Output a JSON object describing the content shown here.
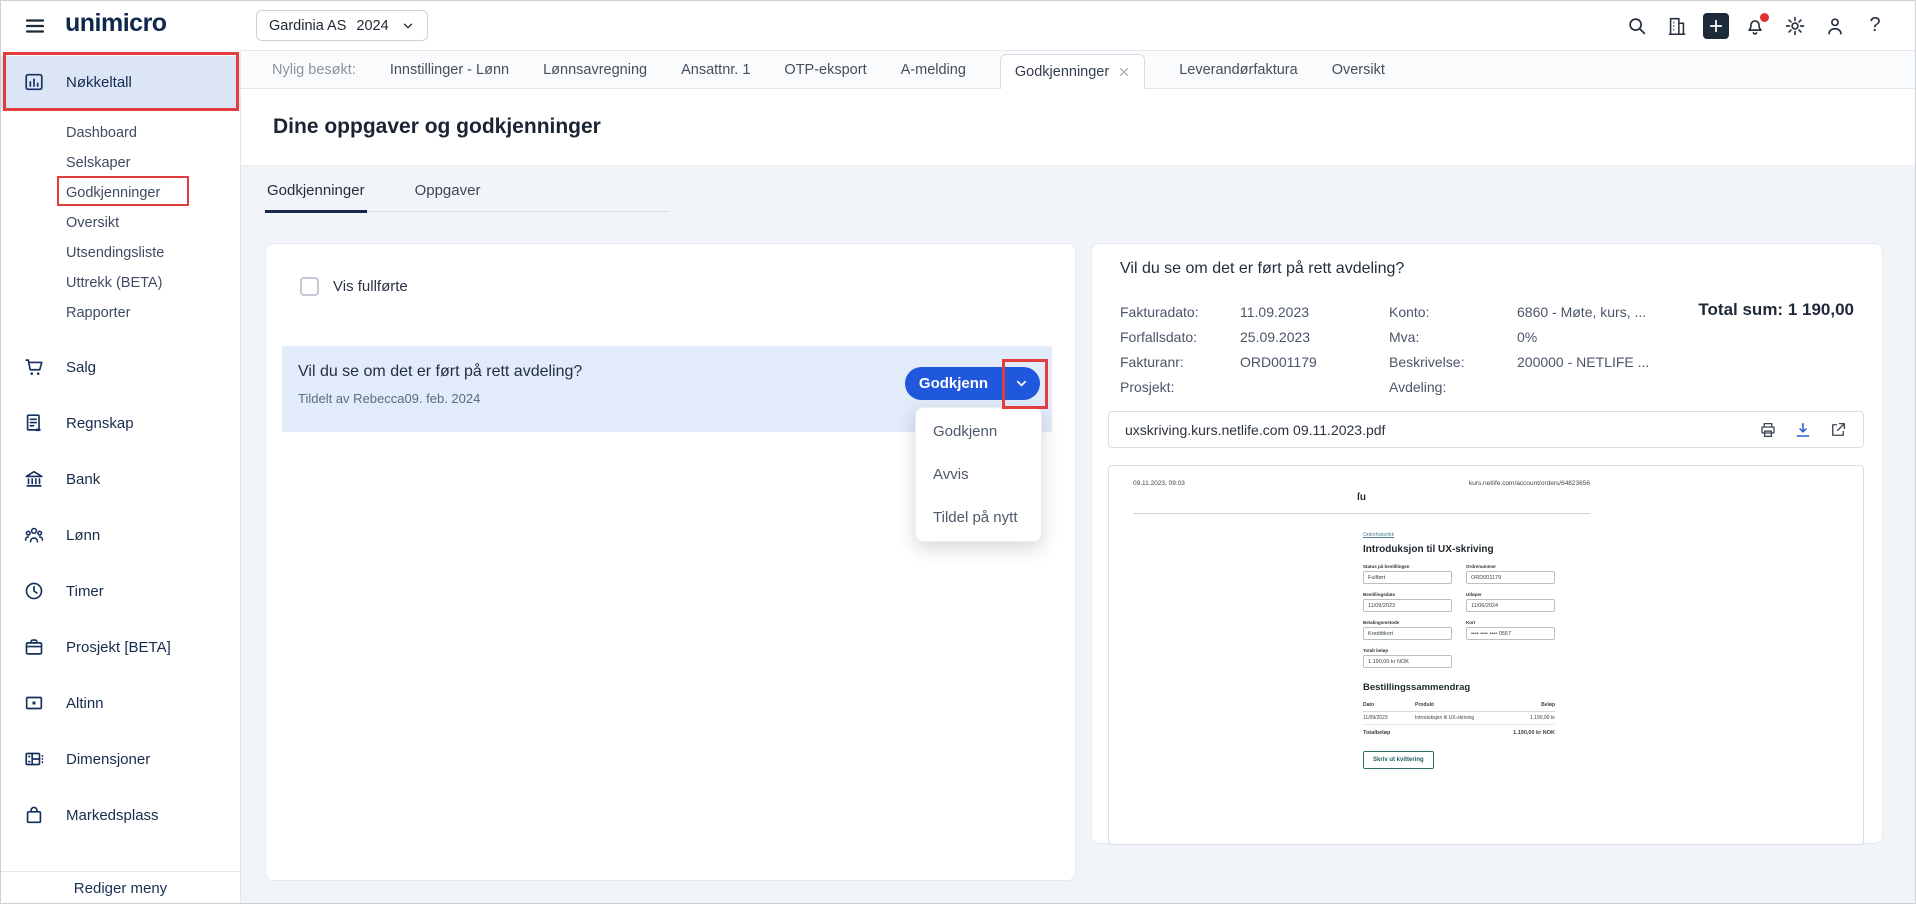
{
  "topbar": {
    "logo": "unimicro",
    "company": "Gardinia AS",
    "year": "2024",
    "icons": [
      "search-icon",
      "company-switcher-icon",
      "quick-add-icon",
      "notifications-bell-icon",
      "settings-gear-icon",
      "profile-icon",
      "help-icon"
    ],
    "help_glyph": "?"
  },
  "sidebar": {
    "items": [
      {
        "label": "Nøkkeltall",
        "icon": "bar-chart-icon"
      },
      {
        "label": "Salg",
        "icon": "cart-icon"
      },
      {
        "label": "Regnskap",
        "icon": "ledger-document-icon"
      },
      {
        "label": "Bank",
        "icon": "bank-icon"
      },
      {
        "label": "Lønn",
        "icon": "people-icon"
      },
      {
        "label": "Timer",
        "icon": "clock-icon"
      },
      {
        "label": "Prosjekt [BETA]",
        "icon": "briefcase-icon"
      },
      {
        "label": "Altinn",
        "icon": "altinn-icon"
      },
      {
        "label": "Dimensjoner",
        "icon": "dimensions-icon"
      },
      {
        "label": "Markedsplass",
        "icon": "shopping-bag-icon"
      }
    ],
    "sub_items": [
      "Dashboard",
      "Selskaper",
      "Godkjenninger",
      "Oversikt",
      "Utsendingsliste",
      "Uttrekk (BETA)",
      "Rapporter"
    ],
    "footer": "Rediger meny"
  },
  "recent": {
    "label": "Nylig besøkt:",
    "tabs": [
      "Innstillinger - Lønn",
      "Lønnsavregning",
      "Ansattnr. 1",
      "OTP-eksport",
      "A-melding"
    ],
    "active_tab": "Godkjenninger",
    "tabs_after": [
      "Leverandørfaktura",
      "Oversikt"
    ]
  },
  "page": {
    "title": "Dine oppgaver og godkjenninger",
    "tab_godkjenninger": "Godkjenninger",
    "tab_oppgaver": "Oppgaver"
  },
  "tasks": {
    "show_completed": "Vis fullførte",
    "task": {
      "title": "Vil du se om det er ført på rett avdeling?",
      "assigned": "Tildelt av Rebecca09. feb. 2024",
      "approve": "Godkjenn"
    },
    "menu": [
      "Godkjenn",
      "Avvis",
      "Tildel på nytt"
    ]
  },
  "detail": {
    "title": "Vil du se om det er ført på rett avdeling?",
    "total": "Total sum: 1 190,00",
    "rows": [
      {
        "l1": "Fakturadato:",
        "v1": "11.09.2023",
        "l2": "Konto:",
        "v2": "6860 - Møte, kurs, ..."
      },
      {
        "l1": "Forfallsdato:",
        "v1": "25.09.2023",
        "l2": "Mva:",
        "v2": "0%"
      },
      {
        "l1": "Fakturanr:",
        "v1": "ORD001179",
        "l2": "Beskrivelse:",
        "v2": "200000 - NETLIFE ..."
      },
      {
        "l1": "Prosjekt:",
        "v1": "",
        "l2": "Avdeling:",
        "v2": ""
      }
    ],
    "pdf_name": "uxskriving.kurs.netlife.com 09.11.2023.pdf",
    "preview": {
      "printed": "09.11.2023, 09:03",
      "url": "kurs.netlife.com/account/orders/64823656",
      "logo": "ſu",
      "link": "Ordrehistorikk",
      "heading": "Introduksjon til UX-skriving",
      "fields": [
        {
          "label": "Status på bestillingen",
          "value": "Fullført"
        },
        {
          "label": "Ordrenummer",
          "value": "ORD001179"
        },
        {
          "label": "Bestillingsdato",
          "value": "11/09/2023"
        },
        {
          "label": "Utløper",
          "value": "11/06/2024"
        },
        {
          "label": "Betalingsmetode",
          "value": "Kredittkort"
        },
        {
          "label": "Kort",
          "value": "•••• •••• •••• 0557"
        },
        {
          "label": "Totalt beløp",
          "value": "1.190,00 kr NOK"
        }
      ],
      "summary_heading": "Bestillingssammendrag",
      "col_date": "Dato",
      "col_product": "Produkt",
      "col_amount": "Beløp",
      "row_date": "11/09/2023",
      "row_product": "Introduksjon til UX-skriving",
      "row_amount": "1.190,00 kr",
      "total_label": "Totalbeløp",
      "total_value": "1.190,00 kr NOK",
      "button": "Skriv ut kvittering"
    }
  },
  "colors": {
    "accent_blue": "#2058dd",
    "annotation_red": "#e23d3d",
    "navy": "#14294d",
    "task_row_blue": "#e2ebfa"
  }
}
